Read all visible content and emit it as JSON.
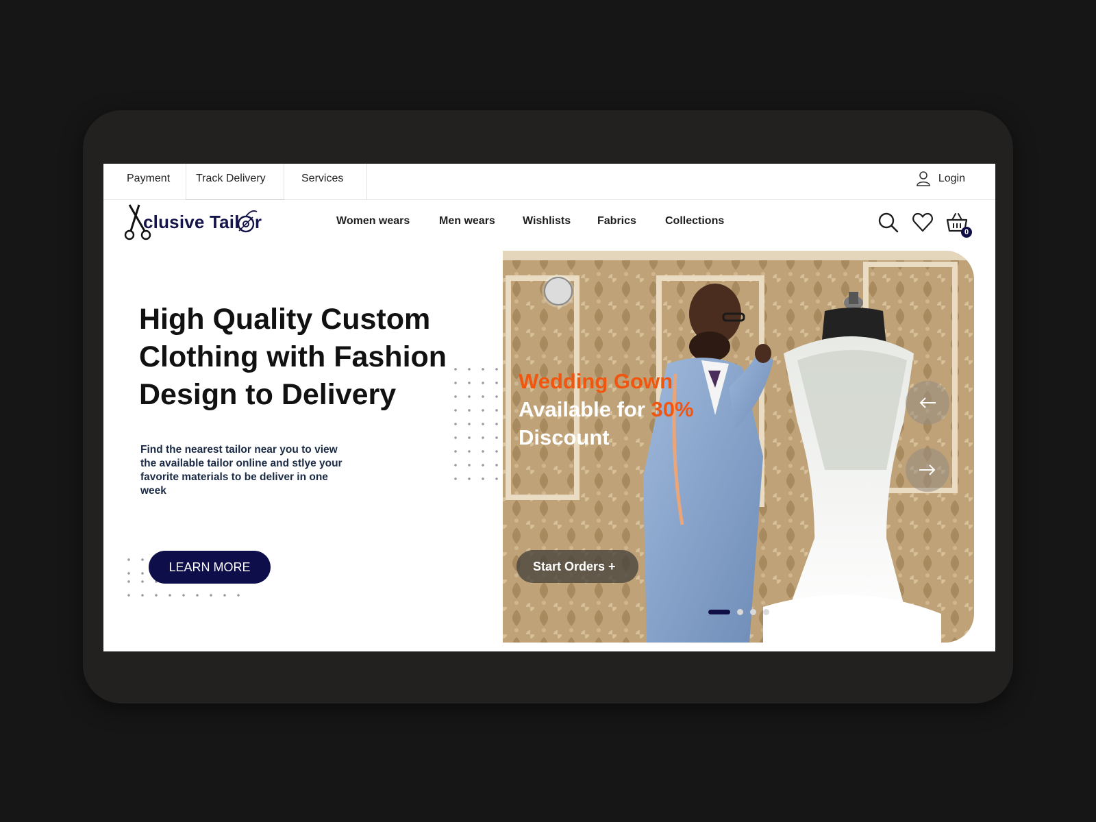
{
  "topbar": {
    "links": [
      "Payment",
      "Track Delivery",
      "Services"
    ],
    "login_label": "Login"
  },
  "brand": {
    "name": "Xclusive Tailor",
    "name_display": "clusive Tail   r"
  },
  "nav": {
    "items": [
      "Women wears",
      "Men wears",
      "Wishlists",
      "Fabrics",
      "Collections"
    ]
  },
  "header_icons": [
    "search-icon",
    "heart-icon",
    "basket-icon"
  ],
  "cart": {
    "count": "0"
  },
  "hero": {
    "headline": "High Quality Custom Clothing with Fashion Design to Delivery",
    "description": "Find the nearest tailor near you to view the available tailor online and stlye your favorite materials to be deliver in one week",
    "cta_label": "LEARN MORE"
  },
  "slide": {
    "title_orange": "Wedding Gown",
    "title_line2": "Available for ",
    "discount": "30%",
    "title_line3": "Discount",
    "cta_label": "Start Orders  +",
    "prev_icon": "arrow-left-icon",
    "next_icon": "arrow-right-icon",
    "pages": 4,
    "active_page": 1
  },
  "colors": {
    "brand_navy": "#0e0e4b",
    "accent_orange": "#f0560f",
    "device_frame": "#222120",
    "background": "#161616"
  }
}
